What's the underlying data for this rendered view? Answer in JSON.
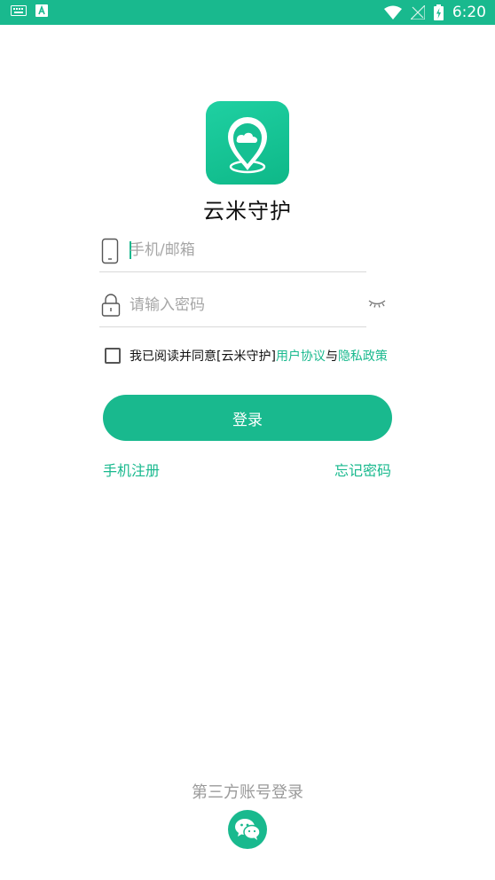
{
  "status_bar": {
    "time": "6:20",
    "left_icons": [
      "keyboard-icon",
      "app-notification-icon"
    ],
    "right_icons": [
      "wifi-icon",
      "no-signal-icon",
      "battery-charging-icon"
    ]
  },
  "app": {
    "name": "云米守护",
    "logo_icon": "location-pin-cloud-icon"
  },
  "login_form": {
    "account_placeholder": "手机/邮箱",
    "account_value": "",
    "password_placeholder": "请输入密码",
    "password_value": "",
    "password_toggle_icon": "eye-closed-icon"
  },
  "agreement": {
    "checked": false,
    "prefix": "我已阅读并同意[云米守护]",
    "user_agreement": "用户协议",
    "conjunction": "与",
    "privacy_policy": "隐私政策"
  },
  "actions": {
    "login": "登录",
    "phone_register": "手机注册",
    "forgot_password": "忘记密码"
  },
  "third_party": {
    "title": "第三方账号登录",
    "wechat_icon": "wechat-icon"
  },
  "colors": {
    "accent": "#19b98e",
    "status_bar": "#19b98e"
  }
}
